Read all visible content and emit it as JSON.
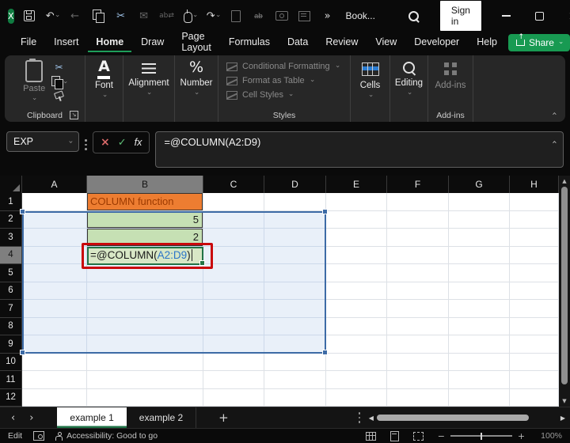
{
  "window": {
    "title": "Book...",
    "sign_in_label": "Sign in"
  },
  "glyphs": {
    "excel_x": "X",
    "undo": "↶",
    "redo": "↷",
    "back": "←",
    "cut": "✂",
    "mail": "✉",
    "find_replace": "ab⇄",
    "strikethrough": "ab",
    "more": "»",
    "chev": "›",
    "chev_left": "‹",
    "cancel": "×",
    "check": "✓",
    "fx": "fx",
    "close": "×",
    "arrow_dl": "↘",
    "arrow_up": "↑",
    "tri_up": "▲",
    "tri_down": "▼",
    "tri_left": "◀",
    "tri_right": "▶",
    "plus": "+",
    "minus": "−",
    "font_a": "A",
    "percent": "%"
  },
  "menu": {
    "tabs": [
      "File",
      "Insert",
      "Home",
      "Draw",
      "Page Layout",
      "Formulas",
      "Data",
      "Review",
      "View",
      "Developer",
      "Help"
    ],
    "active_tab": "Home",
    "share_label": "Share"
  },
  "ribbon": {
    "clipboard": {
      "paste_label": "Paste",
      "group_label": "Clipboard"
    },
    "font": {
      "label": "Font"
    },
    "alignment": {
      "label": "Alignment"
    },
    "number": {
      "label": "Number"
    },
    "styles": {
      "items": [
        "Conditional Formatting",
        "Format as Table",
        "Cell Styles"
      ],
      "group_label": "Styles"
    },
    "cells": {
      "label": "Cells"
    },
    "editing": {
      "label": "Editing"
    },
    "addins": {
      "label": "Add-ins",
      "group_label": "Add-ins"
    }
  },
  "formula_bar": {
    "name_box": "EXP",
    "formula": {
      "prefix": "=@COLUMN(",
      "ref": "A2:D9",
      "suffix": ")"
    }
  },
  "grid": {
    "columns": [
      "A",
      "B",
      "C",
      "D",
      "E",
      "F",
      "G",
      "H"
    ],
    "rows": [
      "1",
      "2",
      "3",
      "4",
      "5",
      "6",
      "7",
      "8",
      "9",
      "10",
      "11",
      "12"
    ],
    "highlight_column": "B",
    "highlight_row": "4",
    "selection_range": "A2:D9",
    "cells": {
      "B1": "COLUMN function",
      "B2": "5",
      "B3": "2"
    },
    "edit_cell": {
      "ref": "B4",
      "prefix": "=@COLUMN(",
      "range_ref": "A2:D9",
      "suffix": ")"
    }
  },
  "sheet_tabs": {
    "tabs": [
      "example 1",
      "example 2"
    ],
    "active": "example 1"
  },
  "status_bar": {
    "mode": "Edit",
    "accessibility": "Accessibility: Good to go",
    "zoom_level": "100%"
  },
  "colors": {
    "accent_green": "#1E9E5A",
    "share_green": "#189A52",
    "b1_fill": "#ED7D31",
    "b1_text": "#9C3A00",
    "value_fill": "#C6E0B4",
    "edit_fill": "#D8E7C6",
    "selection_fill": "#E9F0F9",
    "selection_border": "#3D6BA6",
    "edit_border": "#217346",
    "annotation_red": "#C9080B",
    "ref_blue": "#2B74C9"
  }
}
